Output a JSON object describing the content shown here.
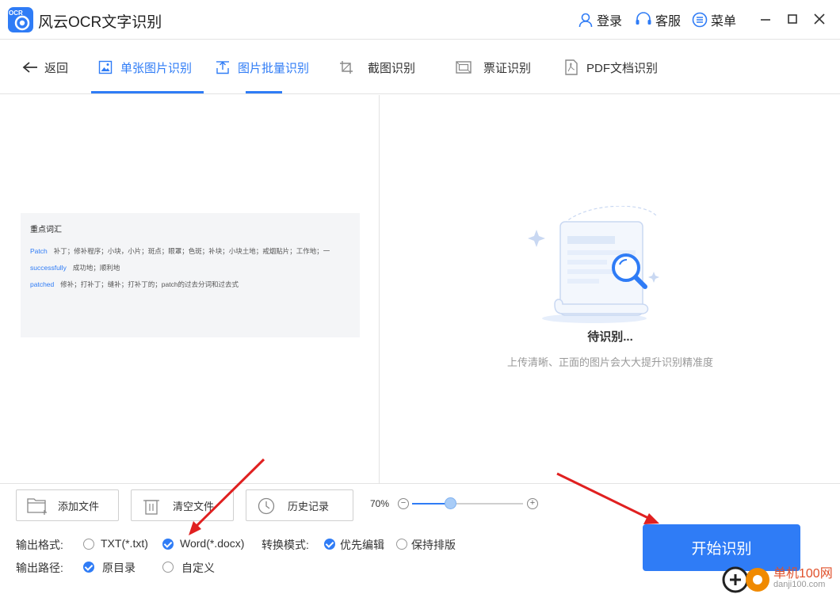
{
  "app": {
    "title": "风云OCR文字识别",
    "logo_text": "OCR"
  },
  "titlebar": {
    "login": "登录",
    "service": "客服",
    "menu": "菜单"
  },
  "nav": {
    "back": "返回",
    "tabs": [
      {
        "label": "单张图片识别",
        "active": true
      },
      {
        "label": "图片批量识别",
        "active": false
      },
      {
        "label": "截图识别",
        "active": false
      },
      {
        "label": "票证识别",
        "active": false
      },
      {
        "label": "PDF文档识别",
        "active": false
      }
    ]
  },
  "preview": {
    "title": "重点词汇",
    "rows": [
      {
        "word": "Patch",
        "meaning": "补丁；修补程序；小块，小片；斑点；眼罩；色斑；补块；小块土地；戒烟贴片；工作地；一"
      },
      {
        "word": "successfully",
        "meaning": "成功地；顺利地"
      },
      {
        "word": "patched",
        "meaning": "修补；打补丁；缝补；打补丁的；patch的过去分词和过去式"
      }
    ]
  },
  "status": {
    "title": "待识别...",
    "description": "上传清晰、正面的图片会大大提升识别精准度"
  },
  "toolbar": {
    "add_file": "添加文件",
    "clear_file": "清空文件",
    "history": "历史记录"
  },
  "zoom": {
    "label": "70%",
    "level": 0.35
  },
  "options": {
    "output_format_label": "输出格式:",
    "format_txt": "TXT(*.txt)",
    "format_word": "Word(*.docx)",
    "mode_label": "转换模式:",
    "mode_edit": "优先编辑",
    "mode_layout": "保持排版",
    "path_label": "输出路径:",
    "path_original": "原目录",
    "path_custom": "自定义"
  },
  "start_button": "开始识别",
  "watermark": {
    "brand": "单机100网",
    "url": "danji100.com"
  },
  "colors": {
    "accent": "#2f7cf6",
    "annotation_arrow": "#e02020"
  }
}
